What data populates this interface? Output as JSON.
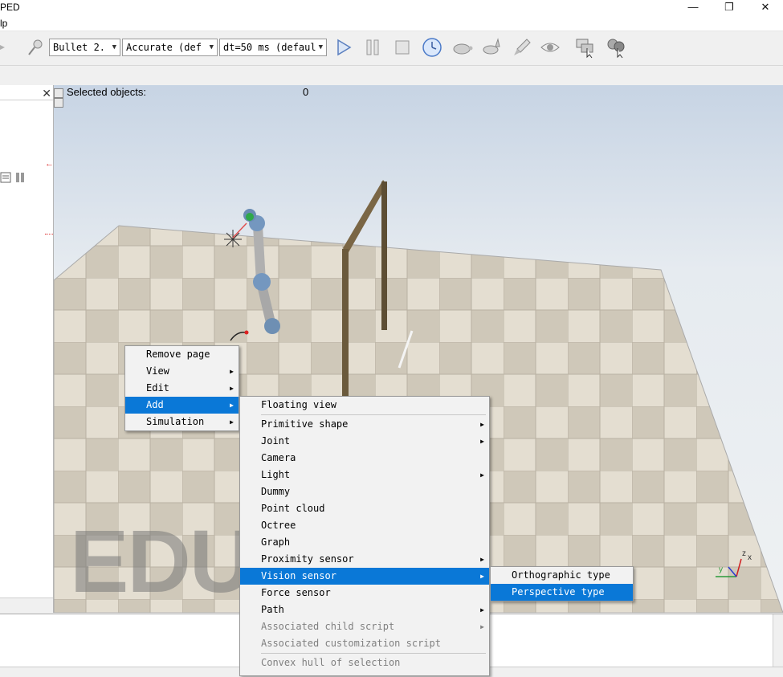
{
  "window": {
    "title": "PED",
    "minimize": "—",
    "restore": "❐",
    "close": "✕"
  },
  "menubar": {
    "partial_item": "lp"
  },
  "toolbar": {
    "engine": "Bullet 2.",
    "accuracy": "Accurate (def",
    "timestep": "dt=50 ms (defaul"
  },
  "viewport": {
    "selected_label": "Selected objects:",
    "selected_count": "0",
    "watermark": "EDU"
  },
  "context_menu": {
    "items": [
      {
        "label": "Remove page",
        "submenu": false
      },
      {
        "label": "View",
        "submenu": true
      },
      {
        "label": "Edit",
        "submenu": true
      },
      {
        "label": "Add",
        "submenu": true,
        "highlighted": true
      },
      {
        "label": "Simulation",
        "submenu": true
      }
    ]
  },
  "add_menu": {
    "items": [
      {
        "label": "Floating view"
      },
      {
        "label": "Primitive shape",
        "submenu": true
      },
      {
        "label": "Joint",
        "submenu": true
      },
      {
        "label": "Camera"
      },
      {
        "label": "Light",
        "submenu": true
      },
      {
        "label": "Dummy"
      },
      {
        "label": "Point cloud"
      },
      {
        "label": "Octree"
      },
      {
        "label": "Graph"
      },
      {
        "label": "Proximity sensor",
        "submenu": true
      },
      {
        "label": "Vision sensor",
        "submenu": true,
        "highlighted": true
      },
      {
        "label": "Force sensor"
      },
      {
        "label": "Path",
        "submenu": true
      },
      {
        "label": "Associated child script",
        "submenu": true,
        "disabled": true
      },
      {
        "label": "Associated customization script",
        "disabled": true
      },
      {
        "label": "Convex hull of selection",
        "disabled": true
      }
    ]
  },
  "vision_menu": {
    "items": [
      {
        "label": "Orthographic type"
      },
      {
        "label": "Perspective type",
        "highlighted": true
      }
    ]
  },
  "axes": {
    "x": "x",
    "y": "y",
    "z": "z"
  },
  "colors": {
    "highlight": "#0a78d7",
    "floor_light": "#e4ded1",
    "floor_dark": "#cbc3b3",
    "frame": "#6b5a3c"
  }
}
